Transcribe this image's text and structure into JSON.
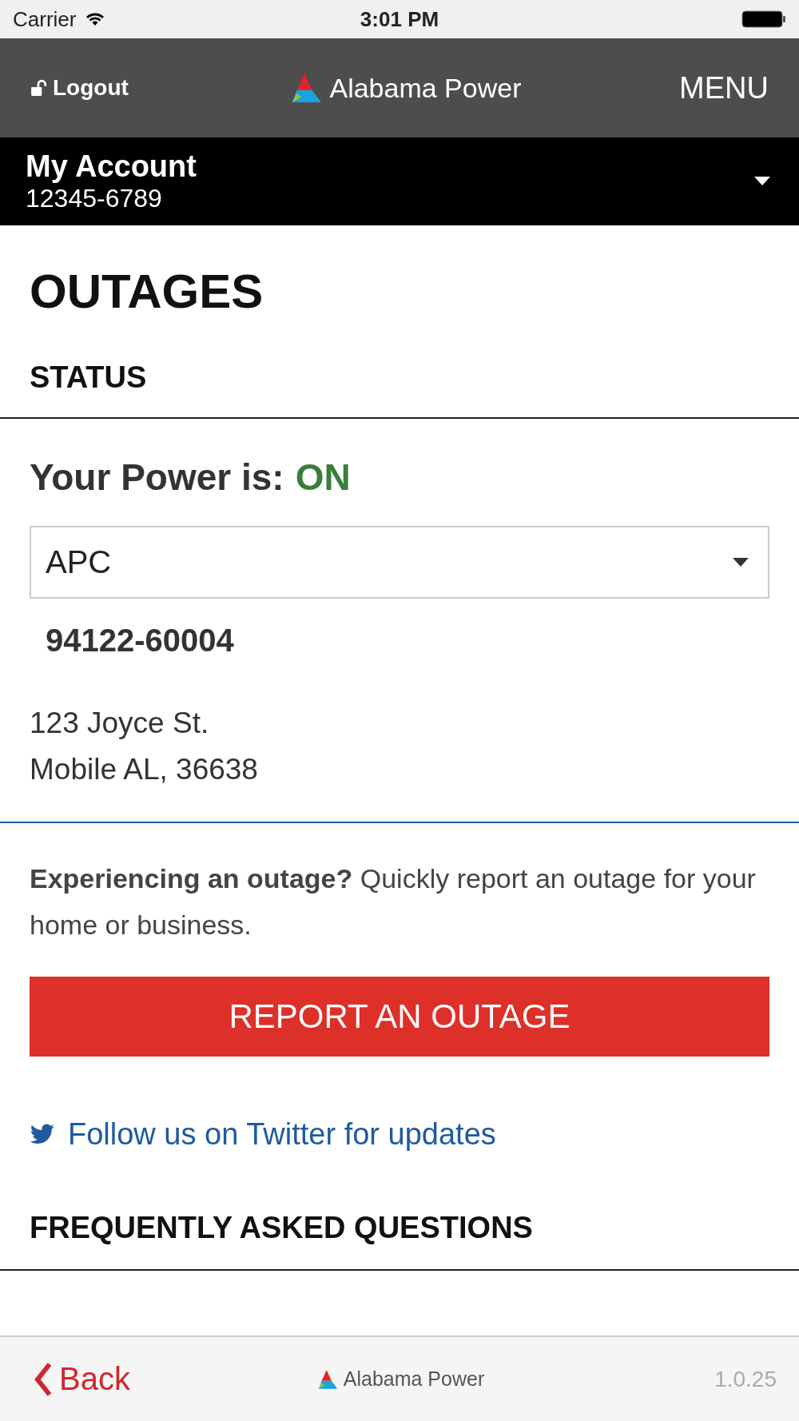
{
  "status_bar": {
    "carrier": "Carrier",
    "time": "3:01 PM"
  },
  "header": {
    "logout": "Logout",
    "brand": "Alabama Power",
    "menu": "MENU"
  },
  "account": {
    "title": "My Account",
    "number": "12345-6789"
  },
  "page_title": "OUTAGES",
  "status_heading": "STATUS",
  "power": {
    "label": "Your Power is:",
    "state": "ON",
    "on": true
  },
  "premise_select": {
    "value": "APC"
  },
  "premise_id": "94122-60004",
  "address": [
    "123 Joyce St.",
    "Mobile AL, 36638"
  ],
  "report_prompt": "**Experiencing an outage?** Quickly report an outage for your home or business.",
  "report_button": "REPORT AN OUTAGE",
  "twitter_link": "Follow us on Twitter for updates",
  "faq_heading": "FREQUENTLY ASKED QUESTIONS",
  "footer": {
    "back": "Back",
    "brand": "Alabama Power",
    "version": "1.0.25"
  }
}
